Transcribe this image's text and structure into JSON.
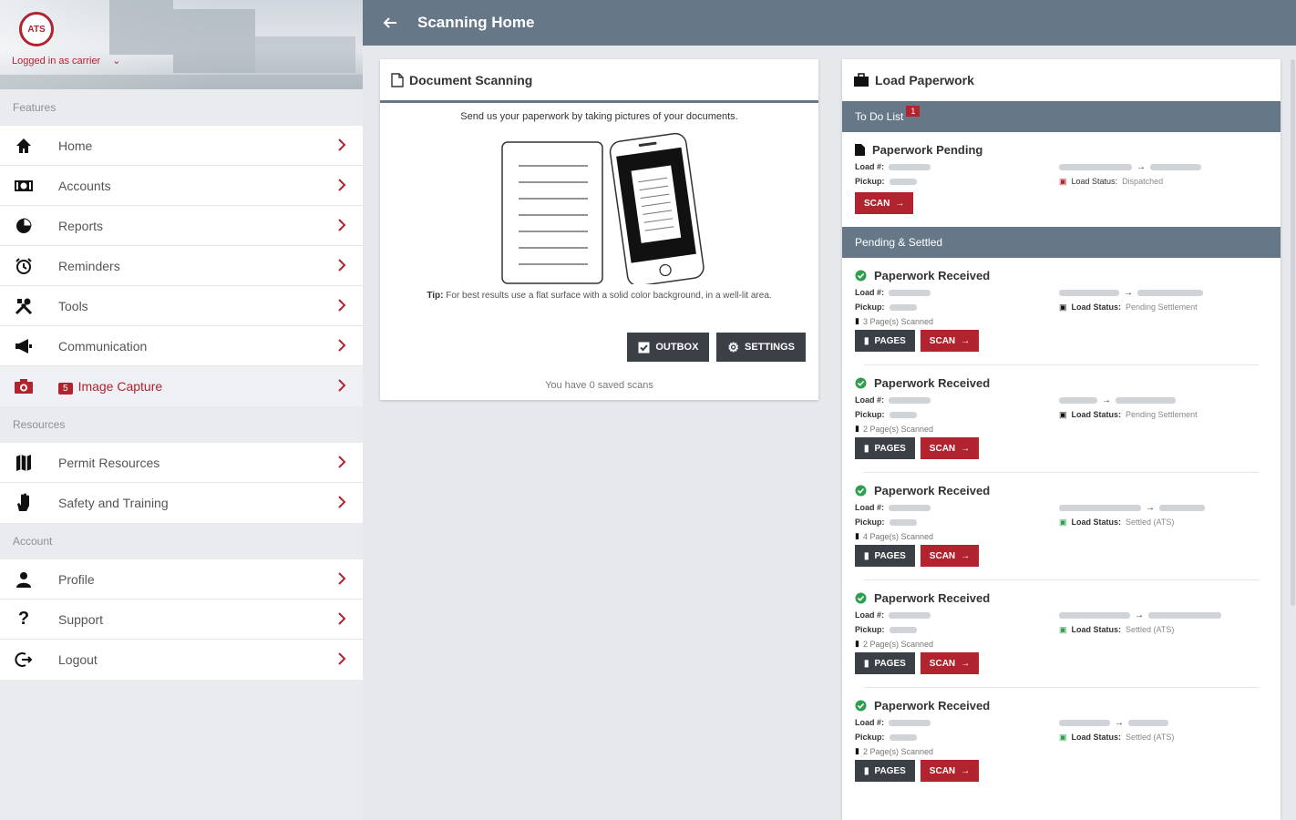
{
  "sidebar": {
    "logo_text": "ATS",
    "logged_in": "Logged in as carrier",
    "sections": {
      "features": "Features",
      "resources": "Resources",
      "account": "Account"
    },
    "features": [
      {
        "label": "Home",
        "icon": "home-icon"
      },
      {
        "label": "Accounts",
        "icon": "money-icon"
      },
      {
        "label": "Reports",
        "icon": "pie-chart-icon"
      },
      {
        "label": "Reminders",
        "icon": "alarm-icon"
      },
      {
        "label": "Tools",
        "icon": "tools-icon"
      },
      {
        "label": "Communication",
        "icon": "megaphone-icon"
      },
      {
        "label": "Image Capture",
        "icon": "camera-icon",
        "badge": "5",
        "active": true
      }
    ],
    "resources": [
      {
        "label": "Permit Resources",
        "icon": "map-icon"
      },
      {
        "label": "Safety and Training",
        "icon": "hand-icon"
      }
    ],
    "account": [
      {
        "label": "Profile",
        "icon": "person-icon"
      },
      {
        "label": "Support",
        "icon": "question-icon"
      },
      {
        "label": "Logout",
        "icon": "logout-icon"
      }
    ]
  },
  "topbar": {
    "title": "Scanning Home"
  },
  "document_scanning": {
    "title": "Document Scanning",
    "intro": "Send us your paperwork by taking pictures of your documents.",
    "tips_label": "Tip:",
    "tips_text": "For best results use a flat surface with a solid color background, in a well-lit area.",
    "outbox_label": "OUTBOX",
    "settings_label": "SETTINGS",
    "saved_text": "You have 0 saved scans"
  },
  "load_paperwork": {
    "title": "Load Paperwork",
    "todo_label": "To Do List",
    "todo_count": "1",
    "pending_settled_label": "Pending & Settled",
    "load_label": "Load #:",
    "pickup_label": "Pickup:",
    "status_label": "Load Status:",
    "pages_label": "PAGES",
    "scan_label": "SCAN",
    "todo_items": [
      {
        "title": "Paperwork Pending",
        "status": "Dispatched"
      }
    ],
    "items": [
      {
        "title": "Paperwork Received",
        "pages_scanned": "3 Page(s) Scanned",
        "status": "Pending Settlement"
      },
      {
        "title": "Paperwork Received",
        "pages_scanned": "2 Page(s) Scanned",
        "status": "Pending Settlement"
      },
      {
        "title": "Paperwork Received",
        "pages_scanned": "4 Page(s) Scanned",
        "status": "Settled (ATS)"
      },
      {
        "title": "Paperwork Received",
        "pages_scanned": "2 Page(s) Scanned",
        "status": "Settled (ATS)"
      },
      {
        "title": "Paperwork Received",
        "pages_scanned": "2 Page(s) Scanned",
        "status": "Settled (ATS)"
      }
    ]
  },
  "colors": {
    "accent": "#b0232f",
    "header": "#667788",
    "dark_button": "#3b4046",
    "success": "#2e9e4f"
  }
}
